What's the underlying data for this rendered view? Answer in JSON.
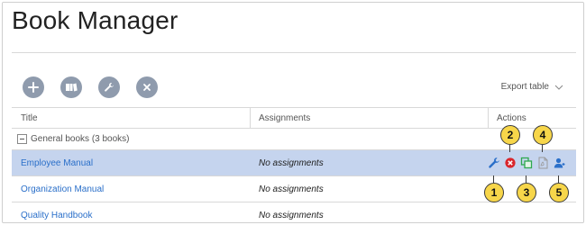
{
  "page": {
    "title": "Book Manager"
  },
  "toolbar": {
    "buttons": [
      {
        "icon": "plus-icon"
      },
      {
        "icon": "books-icon"
      },
      {
        "icon": "wrench-icon"
      },
      {
        "icon": "close-icon"
      }
    ],
    "export_label": "Export table"
  },
  "table": {
    "headers": {
      "title": "Title",
      "assignments": "Assignments",
      "actions": "Actions"
    },
    "group": {
      "label": "General books (3 books)"
    },
    "rows": [
      {
        "title": "Employee Manual",
        "assignments": "No assignments",
        "selected": true
      },
      {
        "title": "Organization Manual",
        "assignments": "No assignments",
        "selected": false
      },
      {
        "title": "Quality Handbook",
        "assignments": "No assignments",
        "selected": false
      }
    ]
  },
  "row_actions": [
    {
      "icon": "wrench-icon",
      "color": "#2a6fc9"
    },
    {
      "icon": "delete-icon",
      "color": "#d9262c"
    },
    {
      "icon": "duplicate-icon",
      "color": "#2fa84f"
    },
    {
      "icon": "pdf-icon",
      "color": "#9a9a9a"
    },
    {
      "icon": "assign-user-icon",
      "color": "#2a6fc9"
    }
  ],
  "callouts": [
    "1",
    "2",
    "3",
    "4",
    "5"
  ],
  "colors": {
    "accent_link": "#2a6fc9",
    "selected_row": "#c5d4ee",
    "toolbar_button": "#8f9bad",
    "callout_fill": "#f7d64a"
  }
}
